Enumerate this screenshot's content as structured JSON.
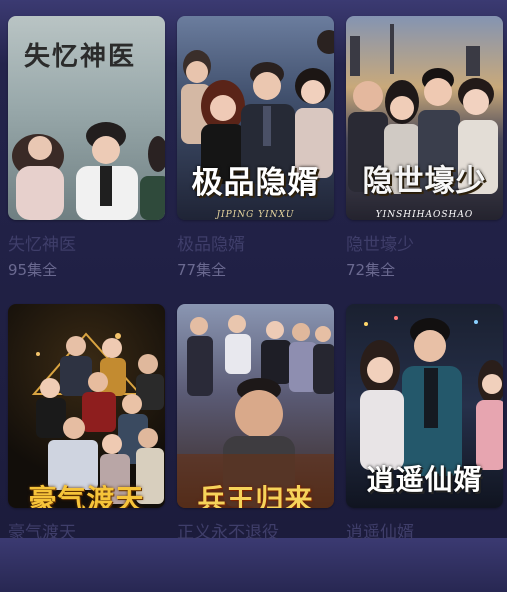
{
  "dramas": [
    {
      "title": "失忆神医",
      "episodes": "95集全",
      "poster_art_text": "失忆神医",
      "poster_theme": "#8fa0a2"
    },
    {
      "title": "极品隐婿",
      "episodes": "77集全",
      "poster_art_text": "极品隐婿",
      "poster_sub_text": "JIPING YINXU",
      "poster_theme": "#2c3550"
    },
    {
      "title": "隐世壕少",
      "episodes": "72集全",
      "poster_art_text": "隐世壕少",
      "poster_sub_text": "YINSHIHAOSHAO",
      "poster_theme": "#3a3f58"
    },
    {
      "title": "豪气渡天",
      "episodes": "",
      "poster_art_text": "豪气渡天",
      "poster_theme": "#1a1410"
    },
    {
      "title": "正义永不退役",
      "episodes": "",
      "poster_art_text": "兵王归来",
      "poster_theme": "#3a3440"
    },
    {
      "title": "逍遥仙婿",
      "episodes": "",
      "poster_art_text": "逍遥仙婿",
      "poster_theme": "#1a2030"
    }
  ]
}
